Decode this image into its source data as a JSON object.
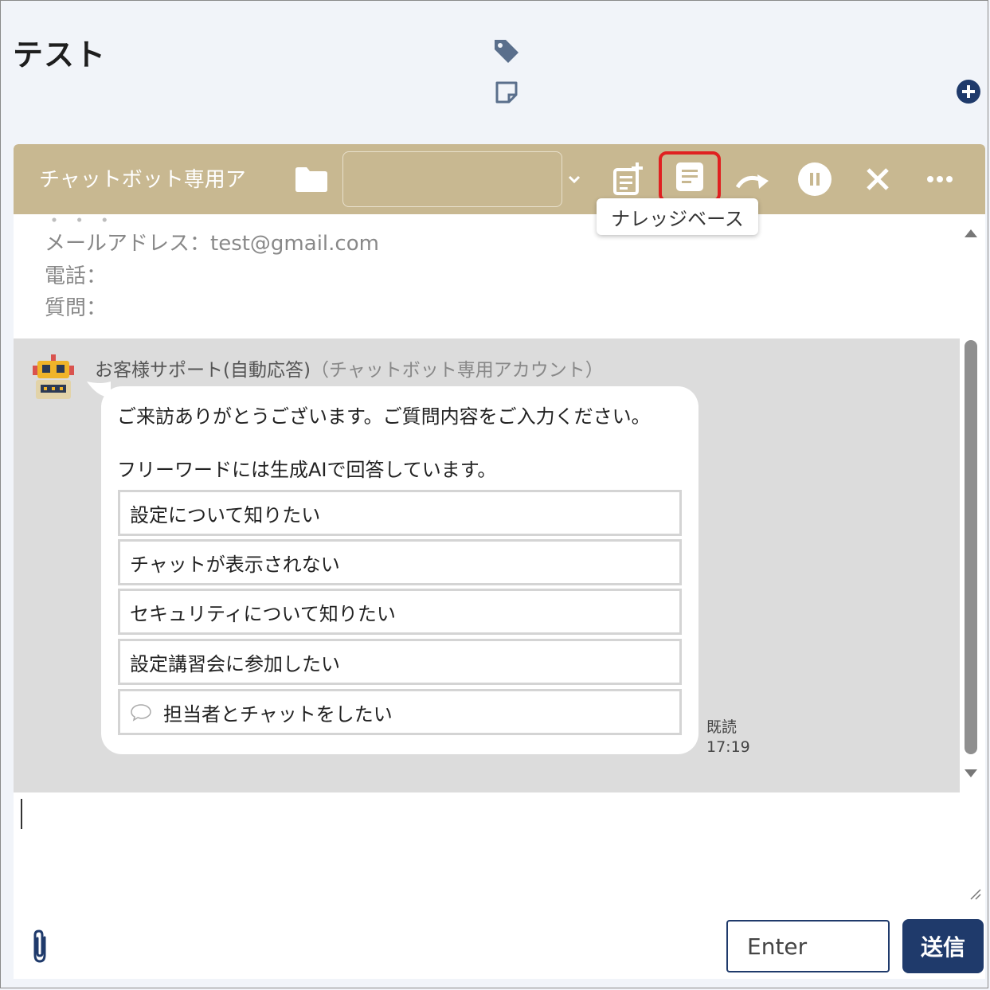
{
  "page": {
    "title": "テスト"
  },
  "header": {
    "title": "チャットボット専用ア",
    "select_value": "",
    "tooltip": "ナレッジベース"
  },
  "info": {
    "lines": [
      "メールアドレス：test@gmail.com",
      "電話：",
      "質問："
    ]
  },
  "message": {
    "sender": "お客様サポート(自動応答)",
    "sender_account": "（チャットボット専用アカウント）",
    "text_1": "ご来訪ありがとうございます。ご質問内容をご入力ください。",
    "text_2": "フリーワードには生成AIで回答しています。",
    "options": [
      "設定について知りたい",
      "チャットが表示されない",
      "セキュリティについて知りたい",
      "設定講習会に参加したい",
      "担当者とチャットをしたい"
    ],
    "read_status": "既読",
    "time": "17:19"
  },
  "composer": {
    "value": "",
    "enter_label": "Enter",
    "send_label": "送信"
  },
  "colors": {
    "header_bg": "#c8b891",
    "primary": "#1f3a6b",
    "highlight": "#e02020"
  },
  "icons": [
    "tag-icon",
    "note-icon",
    "add-circle-icon",
    "folder-icon",
    "chevron-down-icon",
    "memo-add-icon",
    "knowledge-base-icon",
    "forward-icon",
    "pause-icon",
    "close-icon",
    "more-icon",
    "robot-avatar",
    "chat-bubble-icon",
    "paperclip-icon"
  ]
}
